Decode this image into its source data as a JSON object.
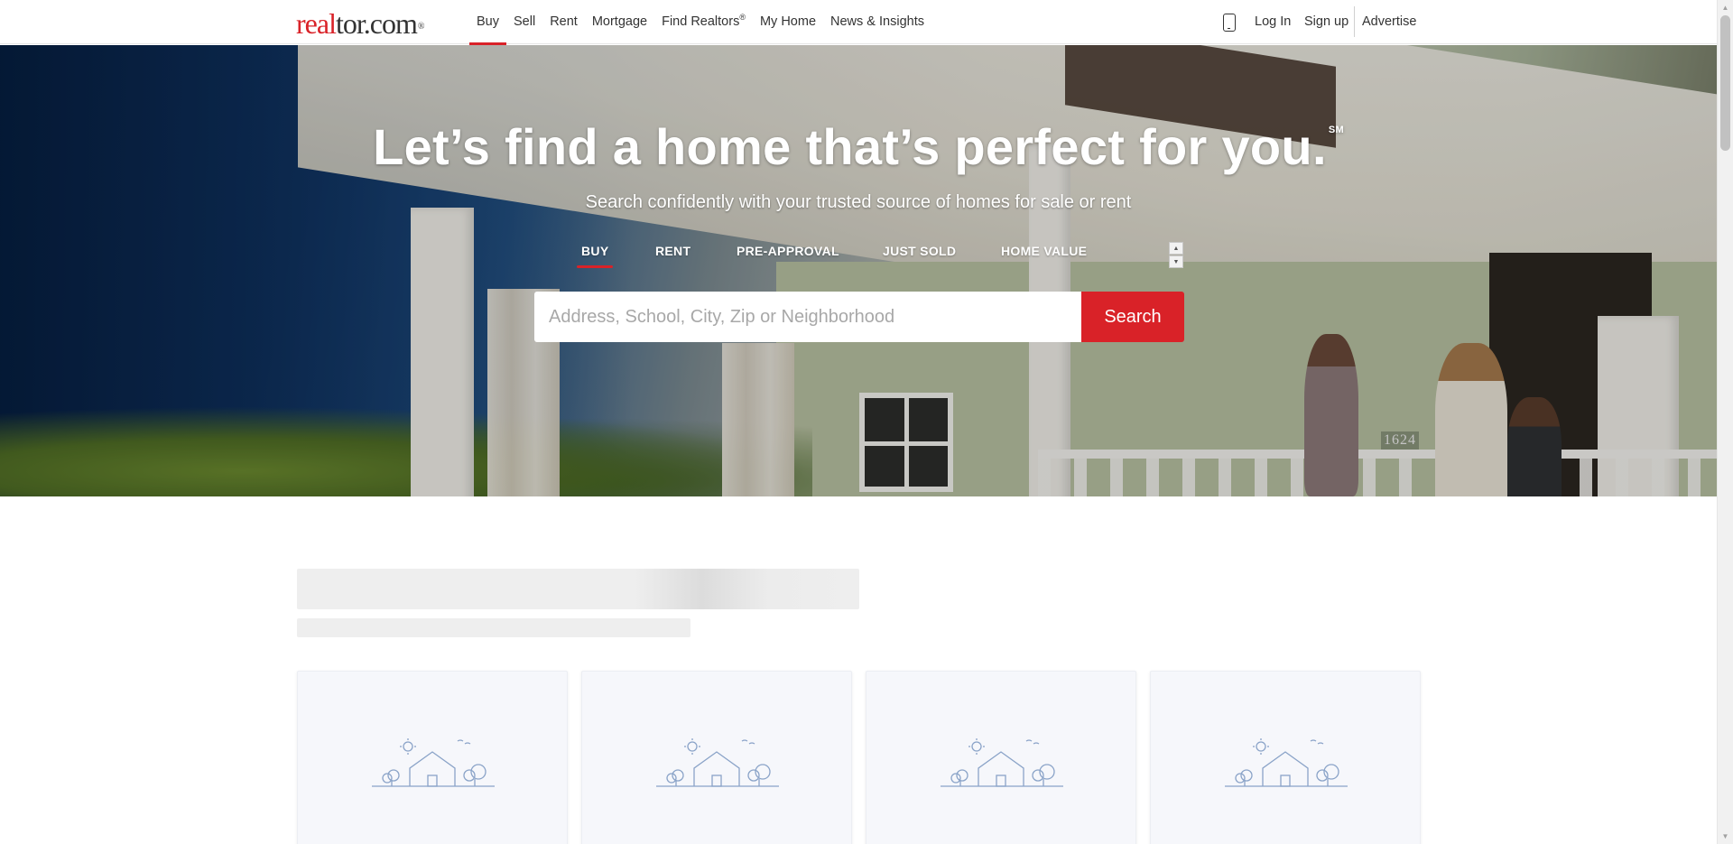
{
  "header": {
    "logo": {
      "part1": "real",
      "part2": "tor.com",
      "mark": "®"
    },
    "nav": [
      {
        "label": "Buy",
        "active": true
      },
      {
        "label": "Sell",
        "active": false
      },
      {
        "label": "Rent",
        "active": false
      },
      {
        "label": "Mortgage",
        "active": false
      },
      {
        "label": "Find Realtors",
        "sup": "®",
        "active": false
      },
      {
        "label": "My Home",
        "active": false
      },
      {
        "label": "News & Insights",
        "active": false
      }
    ],
    "right": {
      "phone_icon": "mobile-phone-icon",
      "login": "Log In",
      "signup": "Sign up",
      "advertise": "Advertise"
    }
  },
  "hero": {
    "title": "Let’s find a home that’s perfect for you.",
    "title_mark": "SM",
    "subtitle": "Search confidently with your trusted source of homes for sale or rent",
    "house_number": "1624",
    "tabs": [
      {
        "label": "BUY",
        "active": true
      },
      {
        "label": "RENT",
        "active": false
      },
      {
        "label": "PRE-APPROVAL",
        "active": false
      },
      {
        "label": "JUST SOLD",
        "active": false
      },
      {
        "label": "HOME VALUE",
        "active": false
      }
    ],
    "search": {
      "placeholder": "Address, School, City, Zip or Neighborhood",
      "value": "",
      "button": "Search"
    }
  },
  "content": {
    "loading": true,
    "cards": [
      {
        "icon": "house-placeholder-icon"
      },
      {
        "icon": "house-placeholder-icon"
      },
      {
        "icon": "house-placeholder-icon"
      },
      {
        "icon": "house-placeholder-icon"
      }
    ]
  },
  "colors": {
    "brand_red": "#d92228",
    "text": "#333333",
    "placeholder_icon": "#8aa3c8",
    "skeleton": "#eeeeee"
  }
}
